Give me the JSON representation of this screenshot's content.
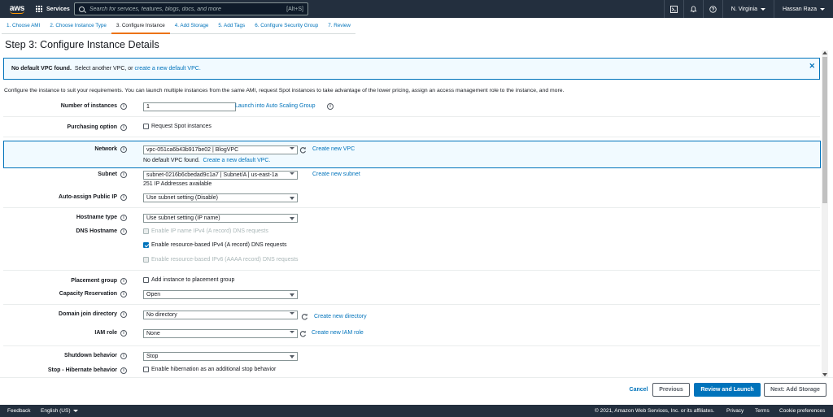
{
  "nav": {
    "logo_text": "aws",
    "services_label": "Services",
    "search_placeholder": "Search for services, features, blogs, docs, and more",
    "search_shortcut": "[Alt+S]",
    "region": "N. Virginia",
    "user": "Hassan Raza"
  },
  "tabs": [
    {
      "label": "1. Choose AMI"
    },
    {
      "label": "2. Choose Instance Type"
    },
    {
      "label": "3. Configure Instance"
    },
    {
      "label": "4. Add Storage"
    },
    {
      "label": "5. Add Tags"
    },
    {
      "label": "6. Configure Security Group"
    },
    {
      "label": "7. Review"
    }
  ],
  "page_title": "Step 3: Configure Instance Details",
  "alert": {
    "bold": "No default VPC found.",
    "text": "Select another VPC, or",
    "link": "create a new default VPC."
  },
  "intro": "Configure the instance to suit your requirements. You can launch multiple instances from the same AMI, request Spot instances to take advantage of the lower pricing, assign an access management role to the instance, and more.",
  "form": {
    "num_instances": {
      "label": "Number of instances",
      "value": "1",
      "link": "Launch into Auto Scaling Group"
    },
    "purchasing": {
      "label": "Purchasing option",
      "checkbox": "Request Spot instances"
    },
    "network": {
      "label": "Network",
      "value": "vpc-051ca6b43b917be02 | BlogVPC",
      "link": "Create new VPC",
      "help_text": "No default VPC found.",
      "help_link": "Create a new default VPC."
    },
    "subnet": {
      "label": "Subnet",
      "value": "subnet-0216b6cbedad9c1a7 | Subnet/A | us-east-1a",
      "link": "Create new subnet",
      "help": "251 IP Addresses available"
    },
    "public_ip": {
      "label": "Auto-assign Public IP",
      "value": "Use subnet setting (Disable)"
    },
    "hostname_type": {
      "label": "Hostname type",
      "value": "Use subnet setting (IP name)"
    },
    "dns_hostname": {
      "label": "DNS Hostname",
      "opt1": "Enable IP name IPv4 (A record) DNS requests",
      "opt2": "Enable resource-based IPv4 (A record) DNS requests",
      "opt3": "Enable resource-based IPv6 (AAAA record) DNS requests"
    },
    "placement": {
      "label": "Placement group",
      "checkbox": "Add instance to placement group"
    },
    "capacity": {
      "label": "Capacity Reservation",
      "value": "Open"
    },
    "domain": {
      "label": "Domain join directory",
      "value": "No directory",
      "link": "Create new directory"
    },
    "iam": {
      "label": "IAM role",
      "value": "None",
      "link": "Create new IAM role"
    },
    "shutdown": {
      "label": "Shutdown behavior",
      "value": "Stop"
    },
    "hibernate": {
      "label": "Stop - Hibernate behavior",
      "checkbox": "Enable hibernation as an additional stop behavior"
    }
  },
  "buttons": {
    "cancel": "Cancel",
    "previous": "Previous",
    "launch": "Review and Launch",
    "next": "Next: Add Storage"
  },
  "footer": {
    "feedback": "Feedback",
    "language": "English (US)",
    "copyright": "© 2021, Amazon Web Services, Inc. or its affiliates.",
    "privacy": "Privacy",
    "terms": "Terms",
    "cookie": "Cookie preferences"
  }
}
